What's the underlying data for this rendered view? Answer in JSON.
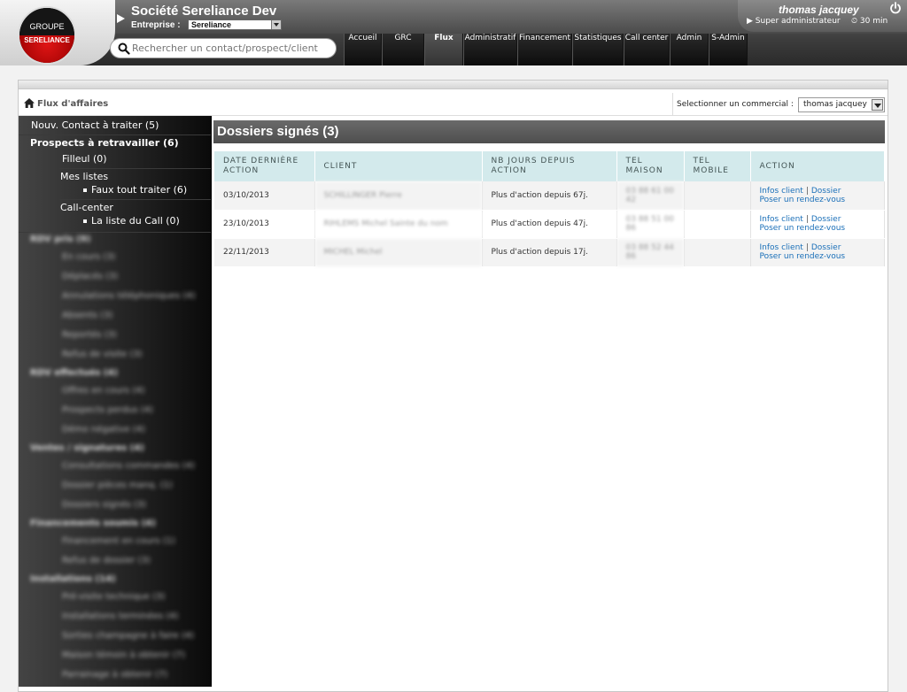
{
  "logo": {
    "line1": "GROUPE",
    "line2": "SERELIANCE"
  },
  "company": {
    "name": "Société Sereliance Dev",
    "entreprise_label": "Entreprise :",
    "entreprise_value": "Sereliance"
  },
  "user": {
    "name": "thomas jacquey",
    "role": "▶ Super administrateur",
    "time": "⏲ 30 min"
  },
  "search": {
    "placeholder": "Rechercher un contact/prospect/client"
  },
  "nav": [
    {
      "label": "Accueil",
      "active": false
    },
    {
      "label": "GRC",
      "active": false
    },
    {
      "label": "Flux",
      "active": true
    },
    {
      "label": "Administratif",
      "active": false
    },
    {
      "label": "Financement",
      "active": false
    },
    {
      "label": "Statistiques",
      "active": false
    },
    {
      "label": "Call center",
      "active": false
    },
    {
      "label": "Admin",
      "active": false
    },
    {
      "label": "S-Admin",
      "active": false
    }
  ],
  "breadcrumb": {
    "label": "Flux d'affaires"
  },
  "commercial": {
    "label": "Selectionner un commercial :",
    "value": "thomas jacquey"
  },
  "sidebar": {
    "nouv_contact": "Nouv. Contact à traiter (5)",
    "prospects": "Prospects à retravailler (6)",
    "filleul": "Filleul (0)",
    "mes_listes": "Mes listes",
    "faux_tout": "Faux tout traiter (6)",
    "call_center": "Call-center",
    "liste_call": "La liste du Call (0)",
    "blurred": [
      {
        "text": "RDV pris (9)",
        "hdr": true
      },
      {
        "text": "En cours (3)",
        "hdr": false
      },
      {
        "text": "Déplacés (3)",
        "hdr": false
      },
      {
        "text": "Annulations téléphoniques (4)",
        "hdr": false
      },
      {
        "text": "Absents (3)",
        "hdr": false
      },
      {
        "text": "Reportés (3)",
        "hdr": false
      },
      {
        "text": "Refus de visite (3)",
        "hdr": false
      },
      {
        "text": "RDV effectués (4)",
        "hdr": true
      },
      {
        "text": "Offres en cours (4)",
        "hdr": false
      },
      {
        "text": "Prospects perdus (4)",
        "hdr": false
      },
      {
        "text": "Démo négative (4)",
        "hdr": false
      },
      {
        "text": "Ventes / signatures (4)",
        "hdr": true
      },
      {
        "text": "Consultations commandes (4)",
        "hdr": false
      },
      {
        "text": "Dossier pièces manq. (1)",
        "hdr": false
      },
      {
        "text": "Dossiers signés (3)",
        "hdr": false
      },
      {
        "text": "Financements soumis (4)",
        "hdr": true
      },
      {
        "text": "Financement en cours (1)",
        "hdr": false
      },
      {
        "text": "Refus de dossier (3)",
        "hdr": false
      },
      {
        "text": "Installations (14)",
        "hdr": true
      },
      {
        "text": "Pré-visite technique (3)",
        "hdr": false
      },
      {
        "text": "Installations terminées (4)",
        "hdr": false
      },
      {
        "text": "Sorties champagne à faire (4)",
        "hdr": false
      },
      {
        "text": "Maison témoin à obtenir (7)",
        "hdr": false
      },
      {
        "text": "Parrainage à obtenir (7)",
        "hdr": false
      }
    ]
  },
  "content": {
    "title": "Dossiers signés (3)",
    "columns": [
      "DATE DERNIÈRE ACTION",
      "CLIENT",
      "NB JOURS DEPUIS ACTION",
      "TEL MAISON",
      "TEL MOBILE",
      "ACTION"
    ],
    "rows": [
      {
        "date": "03/10/2013",
        "client": "SCHILLINGER Pierre",
        "nb": "Plus d'action depuis 67j.",
        "tel_maison": "03 88 61 00 42",
        "tel_mobile": ""
      },
      {
        "date": "23/10/2013",
        "client": "RIHLEMS Michel Sainte du nom",
        "nb": "Plus d'action depuis 47j.",
        "tel_maison": "03 88 51 00 86",
        "tel_mobile": ""
      },
      {
        "date": "22/11/2013",
        "client": "MICHEL Michel",
        "nb": "Plus d'action depuis 17j.",
        "tel_maison": "03 88 52 44 86",
        "tel_mobile": ""
      }
    ],
    "action_infos": "Infos client",
    "action_dossier": "Dossier",
    "action_rdv": "Poser un rendez-vous"
  }
}
